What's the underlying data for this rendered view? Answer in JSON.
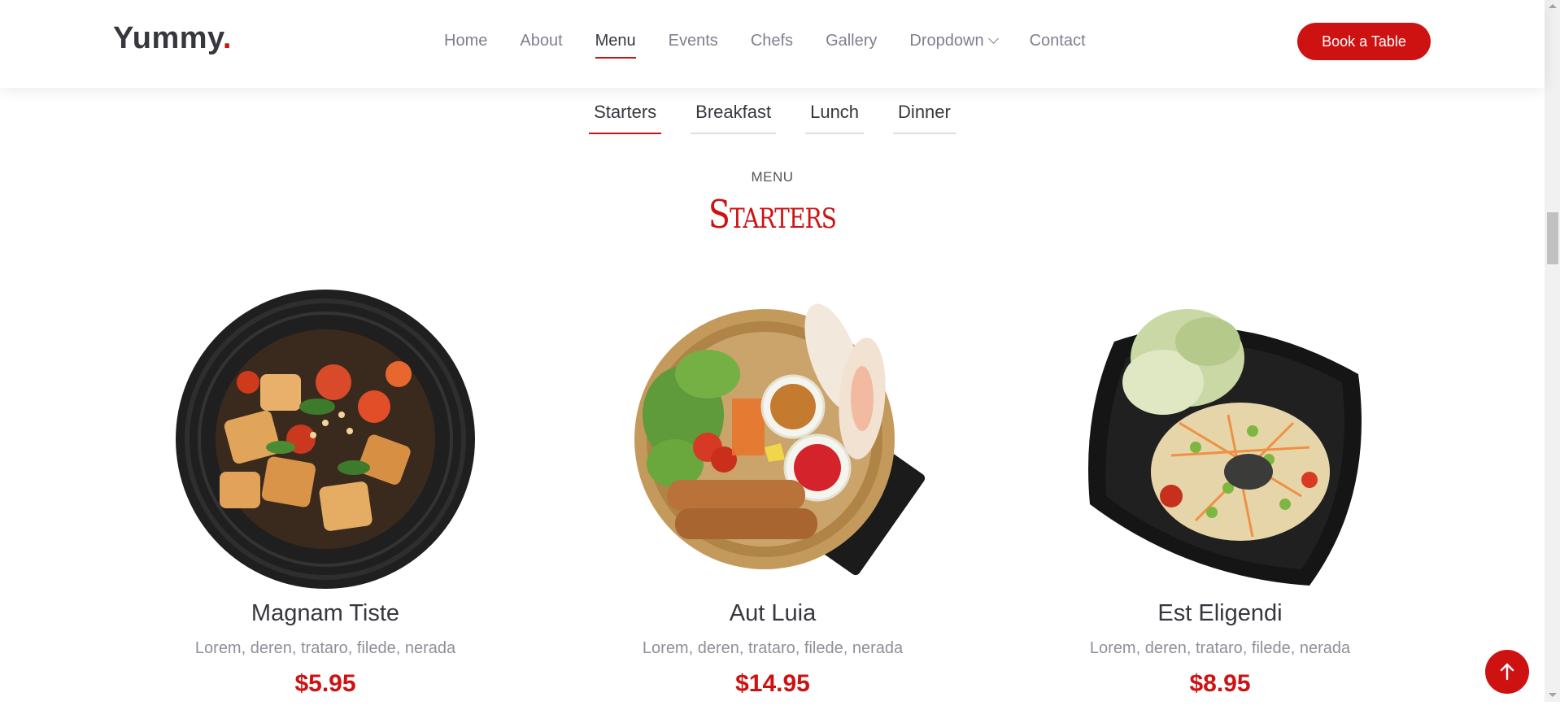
{
  "logo": {
    "text": "Yummy",
    "dot": "."
  },
  "nav": {
    "items": [
      {
        "label": "Home"
      },
      {
        "label": "About"
      },
      {
        "label": "Menu"
      },
      {
        "label": "Events"
      },
      {
        "label": "Chefs"
      },
      {
        "label": "Gallery"
      },
      {
        "label": "Dropdown"
      },
      {
        "label": "Contact"
      }
    ],
    "active": "Menu"
  },
  "header": {
    "book_label": "Book a Table"
  },
  "tabs": [
    {
      "label": "Starters"
    },
    {
      "label": "Breakfast"
    },
    {
      "label": "Lunch"
    },
    {
      "label": "Dinner"
    }
  ],
  "section": {
    "subtitle": "MENU",
    "title": "Starters"
  },
  "items": [
    {
      "name": "Magnam Tiste",
      "ingredients": "Lorem, deren, trataro, filede, nerada",
      "price": "$5.95"
    },
    {
      "name": "Aut Luia",
      "ingredients": "Lorem, deren, trataro, filede, nerada",
      "price": "$14.95"
    },
    {
      "name": "Est Eligendi",
      "ingredients": "Lorem, deren, trataro, filede, nerada",
      "price": "$8.95"
    }
  ],
  "colors": {
    "accent": "#ce1212",
    "text": "#37373f",
    "muted": "#7f7f90"
  },
  "icons": {
    "scroll_top": "arrow-up-icon",
    "dropdown": "chevron-down-icon"
  }
}
